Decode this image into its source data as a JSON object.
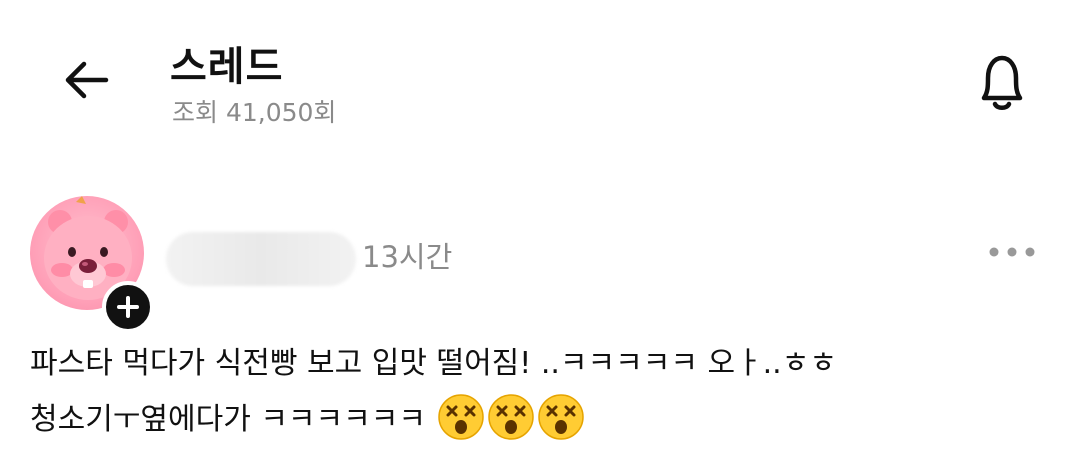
{
  "header": {
    "title": "스레드",
    "views": "조회 41,050회"
  },
  "post": {
    "time": "13시간",
    "text_line1": "파스타 먹다가 식전빵 보고 입맛 떨어짐! ..ㅋㅋㅋㅋㅋ 오ㅏ..ㅎㅎ",
    "text_line2": "청소기ㅜ옆에다가 ㅋㅋㅋㅋㅋㅋ",
    "emoji_count": 3,
    "emoji_name": "dizzy-face",
    "avatar_colors": {
      "skin": "#ff9fb7",
      "nose": "#7a1f3a"
    }
  },
  "icons": {
    "back": "arrow-left-icon",
    "bell": "bell-icon",
    "more": "more-dots-icon",
    "follow": "plus-icon"
  }
}
